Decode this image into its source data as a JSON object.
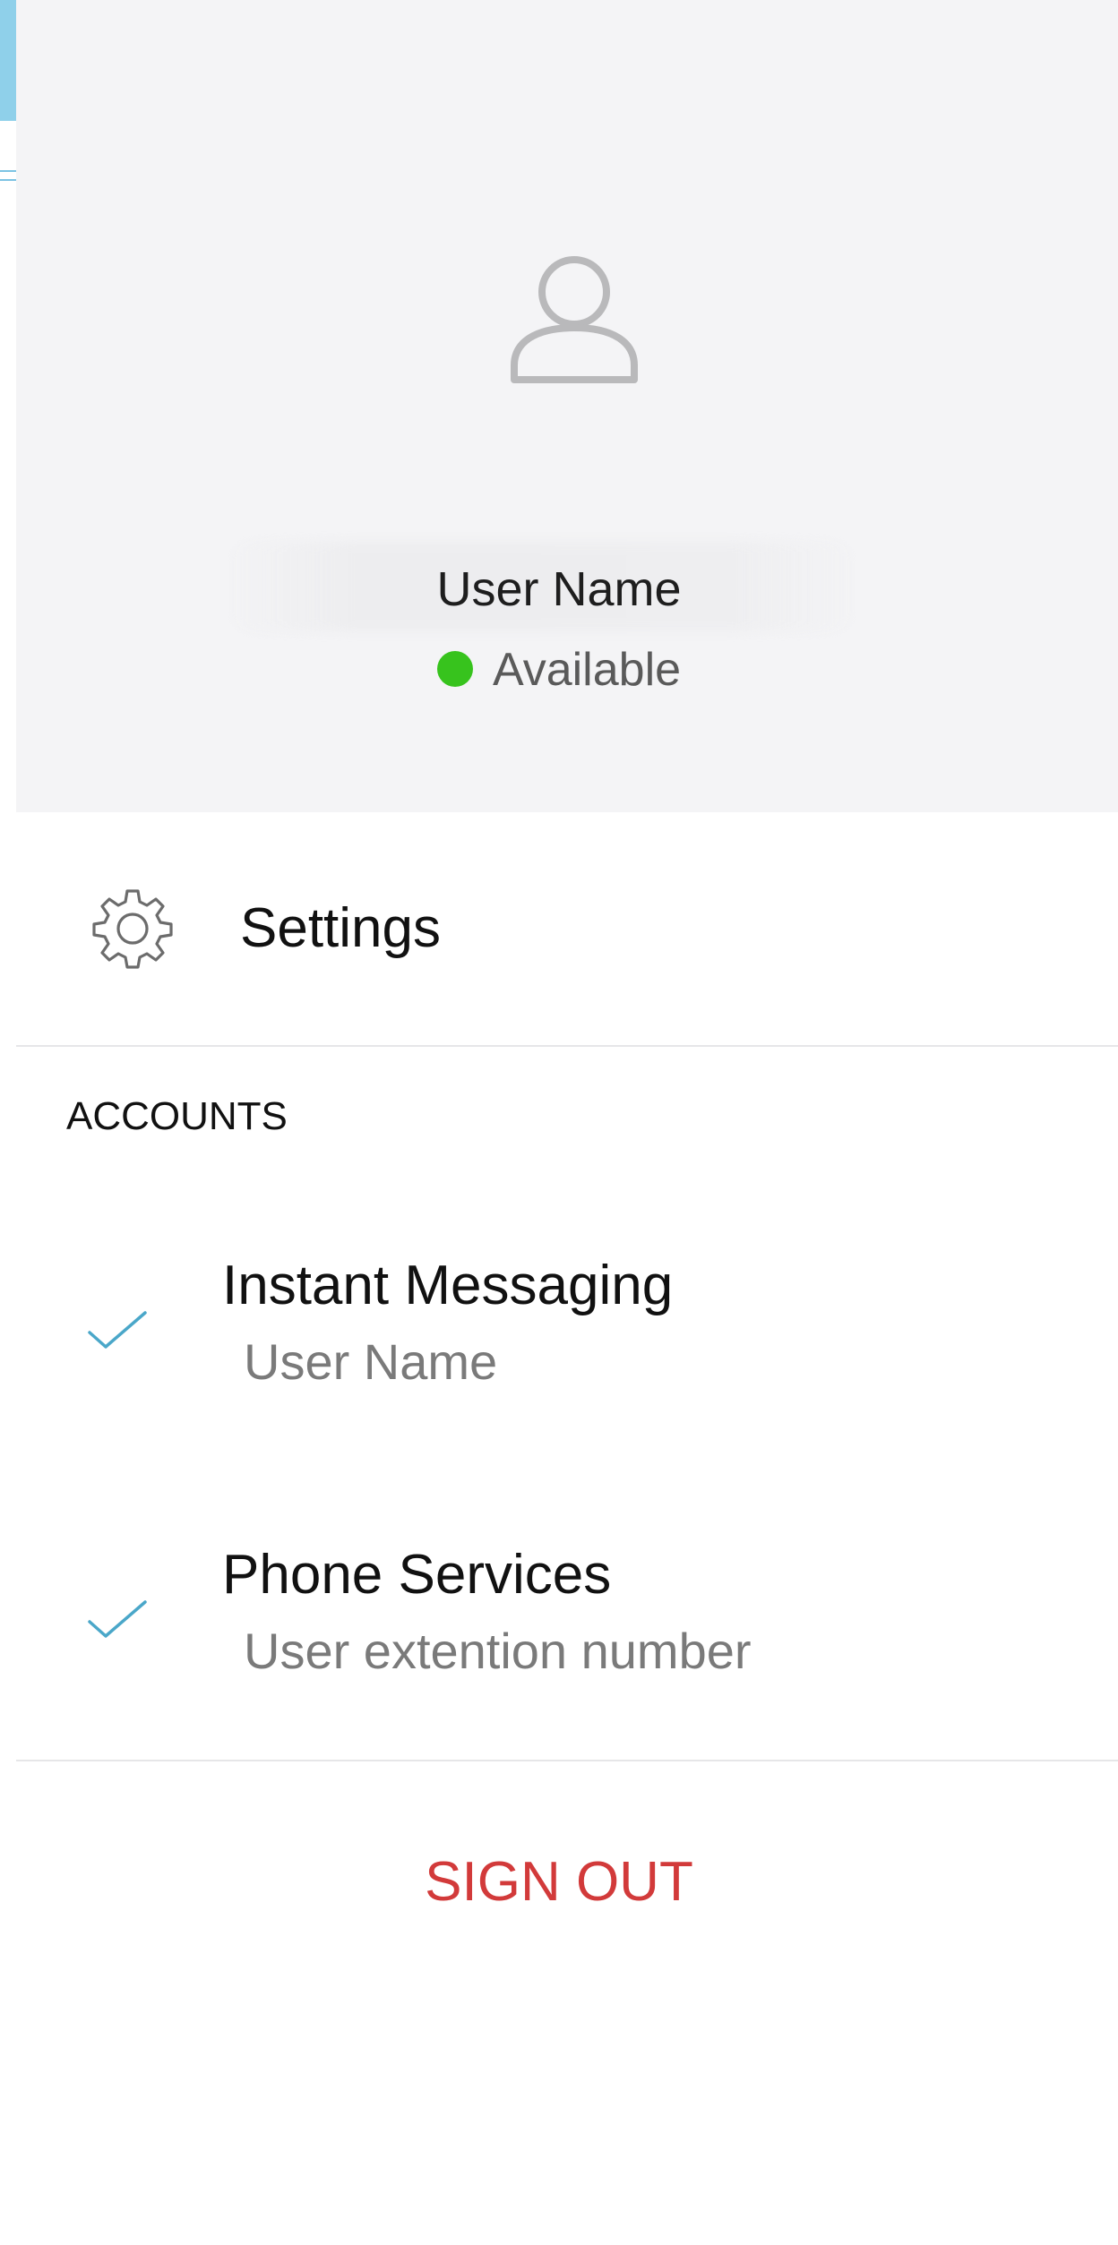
{
  "profile": {
    "user_name": "User Name",
    "status_text": "Available",
    "status_color": "#37c31d",
    "avatar_icon": "user-icon"
  },
  "menu": {
    "settings_label": "Settings",
    "settings_icon": "gear-icon"
  },
  "accounts": {
    "section_title": "ACCOUNTS",
    "items": [
      {
        "title": "Instant Messaging",
        "subtitle": "User Name",
        "checked": true
      },
      {
        "title": "Phone Services",
        "subtitle": "User extention number",
        "checked": true
      }
    ]
  },
  "actions": {
    "sign_out_label": "SIGN OUT",
    "sign_out_color": "#d23a3a"
  },
  "colors": {
    "header_bg": "#f4f4f6",
    "check": "#4aa7c9"
  }
}
